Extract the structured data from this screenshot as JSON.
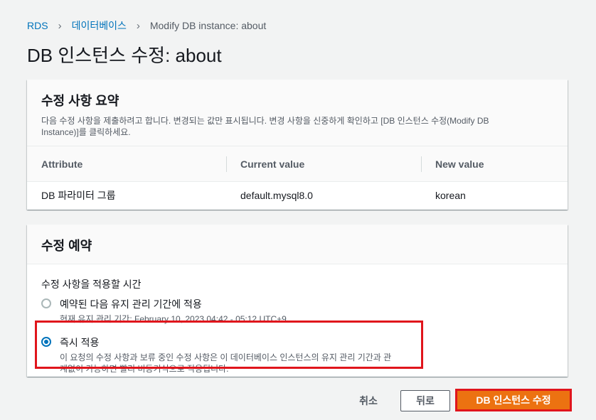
{
  "breadcrumb": {
    "items": [
      "RDS",
      "데이터베이스"
    ],
    "current": "Modify DB instance: about"
  },
  "page_title": "DB 인스턴스 수정: about",
  "summary": {
    "title": "수정 사항 요약",
    "description_line1": "다음 수정 사항을 제출하려고 합니다. 변경되는 값만 표시됩니다. 변경 사항을 신중하게 확인하고 [DB 인스턴스 수정(Modify DB",
    "description_line2": "Instance)]를 클릭하세요.",
    "columns": [
      "Attribute",
      "Current value",
      "New value"
    ],
    "rows": [
      {
        "attribute": "DB 파라미터 그룹",
        "current": "default.mysql8.0",
        "new": "korean"
      }
    ]
  },
  "schedule": {
    "title": "수정 예약",
    "field_label": "수정 사항을 적용할 시간",
    "options": [
      {
        "title": "예약된 다음 유지 관리 기간에 적용",
        "desc_line1": "현재 유지 관리 기간: February 10, 2023 04:42 - 05:12 UTC+9",
        "desc_line2": "",
        "selected": false
      },
      {
        "title": "즉시 적용",
        "desc_line1": "이 요청의 수정 사항과 보류 중인 수정 사항은 이 데이터베이스 인스턴스의 유지 관리 기간과 관",
        "desc_line2": "계없이 가능하면 빨리 비동기식으로 적용됩니다.",
        "selected": true
      }
    ]
  },
  "footer": {
    "cancel_label": "취소",
    "back_label": "뒤로",
    "submit_label": "DB 인스턴스 수정"
  },
  "colors": {
    "accent": "#ec7211",
    "link": "#0073bb",
    "highlight": "#e0151c"
  }
}
